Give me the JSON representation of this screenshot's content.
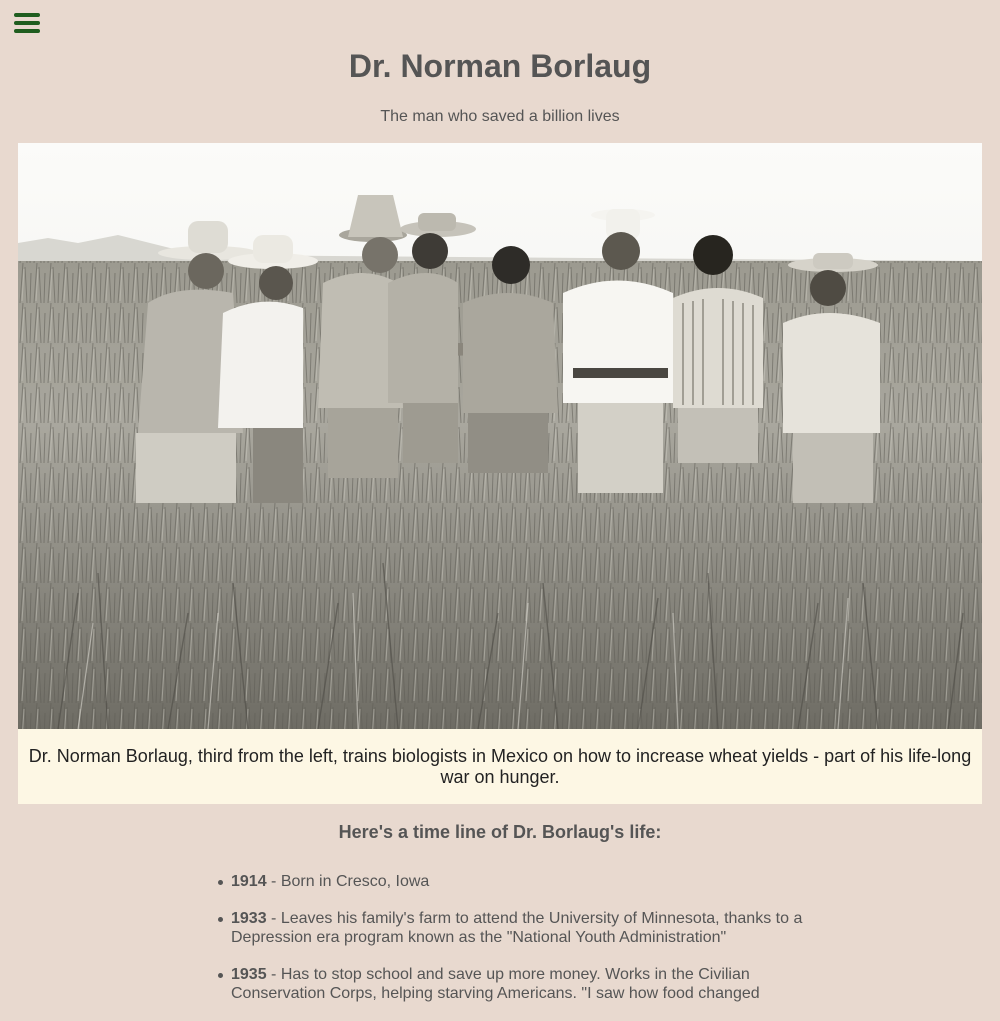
{
  "nav": {
    "menu_icon": "hamburger-menu-icon",
    "menu_color": "#1f5d1f"
  },
  "header": {
    "title": "Dr. Norman Borlaug",
    "tagline": "The man who saved a billion lives"
  },
  "photo": {
    "caption": "Dr. Norman Borlaug, third from the left, trains biologists in Mexico on how to increase wheat yields - part of his life-long war on hunger."
  },
  "timeline": {
    "heading": "Here's a time line of Dr. Borlaug's life:",
    "items": [
      {
        "year": "1914",
        "text": " - Born in Cresco, Iowa"
      },
      {
        "year": "1933",
        "text": " - Leaves his family's farm to attend the University of Minnesota, thanks to a Depression era program known as the \"National Youth Administration\""
      },
      {
        "year": "1935",
        "text": " - Has to stop school and save up more money. Works in the Civilian Conservation Corps, helping starving Americans. \"I saw how food changed"
      }
    ]
  },
  "colors": {
    "background": "#e8d9cf",
    "caption_background": "#fdf7e4",
    "text": "#555555"
  }
}
